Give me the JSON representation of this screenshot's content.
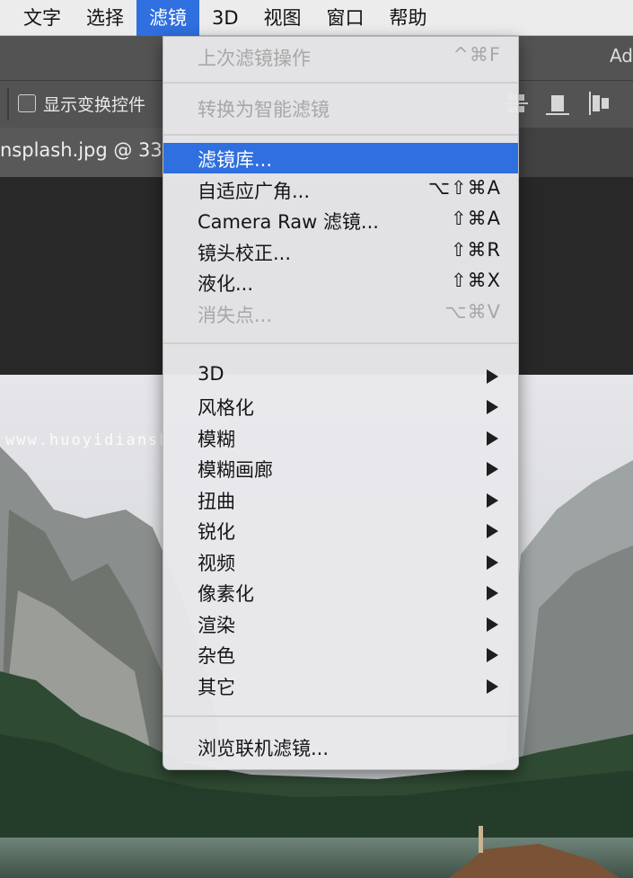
{
  "menubar": {
    "items": [
      {
        "label": "文字",
        "active": false
      },
      {
        "label": "选择",
        "active": false
      },
      {
        "label": "滤镜",
        "active": true
      },
      {
        "label": "3D",
        "active": false
      },
      {
        "label": "视图",
        "active": false
      },
      {
        "label": "窗口",
        "active": false
      },
      {
        "label": "帮助",
        "active": false
      }
    ]
  },
  "app": {
    "title_fragment": "Ad"
  },
  "options": {
    "show_transform_controls": "显示变换控件",
    "checked": false
  },
  "document": {
    "tab_title": "nsplash.jpg @ 33"
  },
  "watermark": "www.huoyidianshe.com",
  "filter_menu": {
    "last_filter": {
      "label": "上次滤镜操作",
      "shortcut": "^⌘F"
    },
    "convert_smart": {
      "label": "转换为智能滤镜"
    },
    "group1": [
      {
        "label": "滤镜库...",
        "shortcut": ""
      },
      {
        "label": "自适应广角...",
        "shortcut": "⌥⇧⌘A"
      },
      {
        "label": "Camera Raw 滤镜...",
        "shortcut": "⇧⌘A"
      },
      {
        "label": "镜头校正...",
        "shortcut": "⇧⌘R"
      },
      {
        "label": "液化...",
        "shortcut": "⇧⌘X"
      },
      {
        "label": "消失点...",
        "shortcut": "⌥⌘V"
      }
    ],
    "submenus": [
      "3D",
      "风格化",
      "模糊",
      "模糊画廊",
      "扭曲",
      "锐化",
      "视频",
      "像素化",
      "渲染",
      "杂色",
      "其它"
    ],
    "browse_online": "浏览联机滤镜..."
  },
  "colors": {
    "highlight": "#2f6fe0",
    "menu_bg": "#e8e8eb",
    "disabled": "#a7a7a7"
  }
}
